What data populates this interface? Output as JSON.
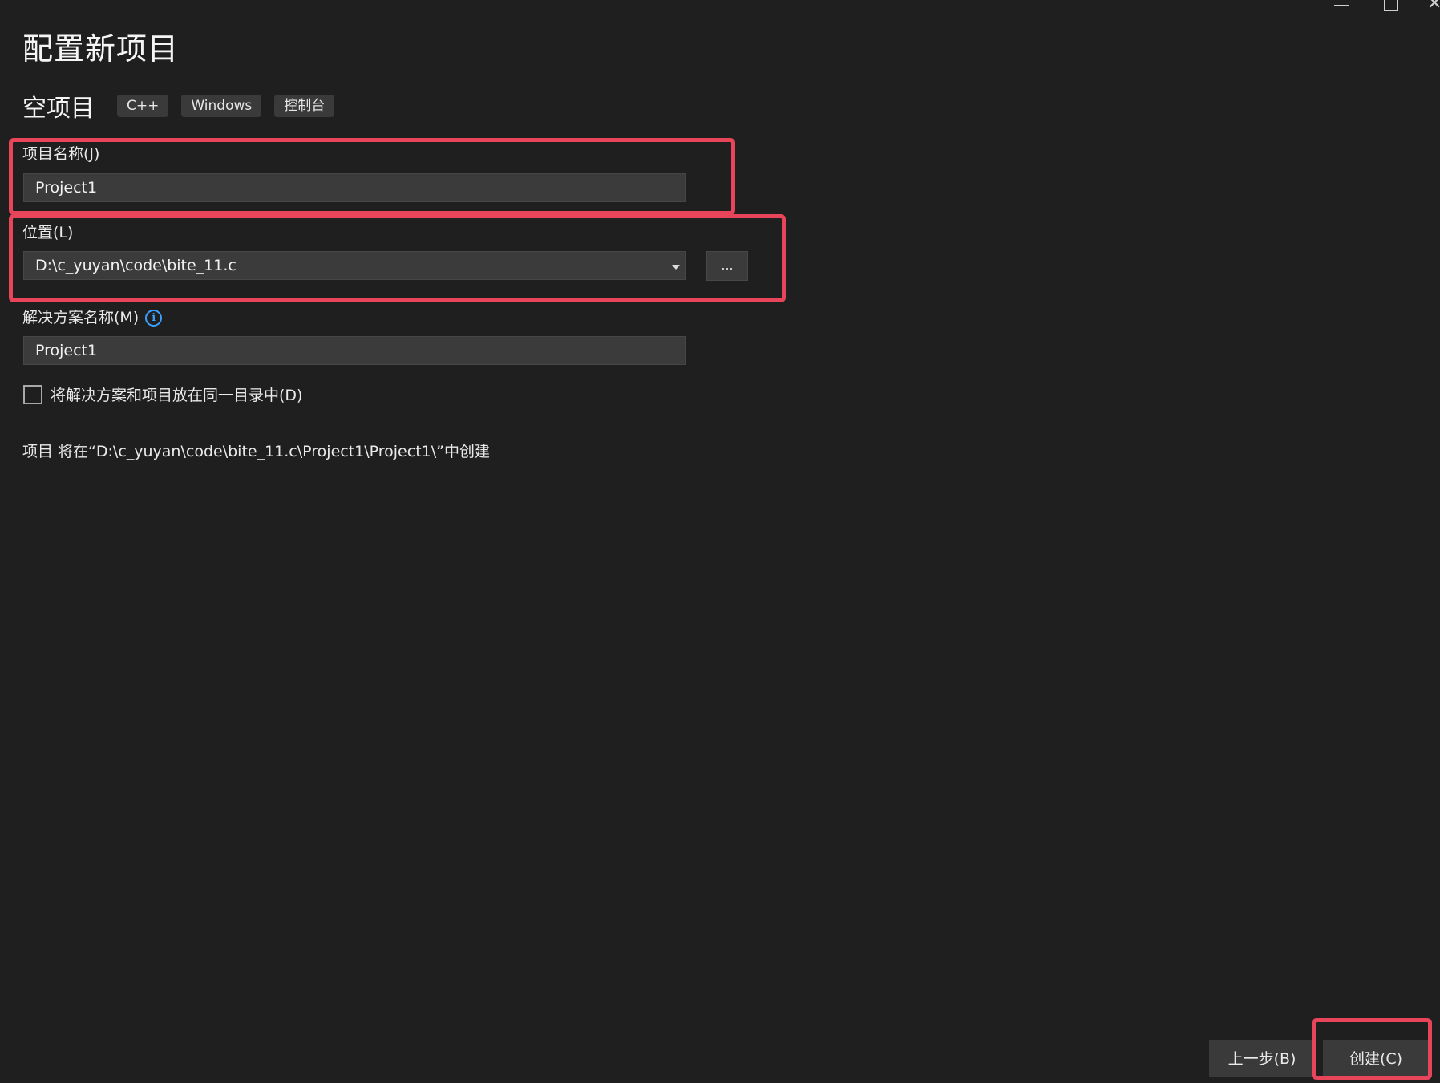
{
  "window": {
    "minimize_label": "minimize",
    "maximize_label": "maximize",
    "close_glyph": "✕"
  },
  "page": {
    "title": "配置新项目"
  },
  "template": {
    "name": "空项目",
    "tags": [
      "C++",
      "Windows",
      "控制台"
    ]
  },
  "project_name": {
    "label": "项目名称(J)",
    "value": "Project1"
  },
  "location": {
    "label": "位置(L)",
    "value": "D:\\c_yuyan\\code\\bite_11.c",
    "browse_label": "..."
  },
  "solution_name": {
    "label": "解决方案名称(M)",
    "value": "Project1",
    "info_icon": "info-icon"
  },
  "same_directory": {
    "label": "将解决方案和项目放在同一目录中(D)",
    "checked": false
  },
  "path_info": "项目 将在“D:\\c_yuyan\\code\\bite_11.c\\Project1\\Project1\\”中创建",
  "footer": {
    "back_label": "上一步(B)",
    "create_label": "创建(C)"
  },
  "colors": {
    "background": "#1f1f1f",
    "input_bg": "#3b3b3b",
    "highlight": "#e8455a",
    "info": "#3aa0ff"
  }
}
